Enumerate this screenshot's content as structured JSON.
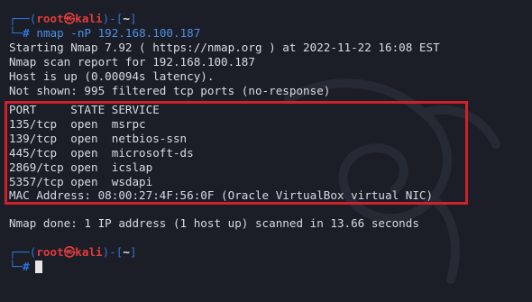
{
  "prompt": {
    "user": "root",
    "symbol": "㉿",
    "host": "kali",
    "dir": "~"
  },
  "command": "nmap -nP 192.168.100.187",
  "output": [
    "Starting Nmap 7.92 ( https://nmap.org ) at 2022-11-22 16:08 EST",
    "Nmap scan report for 192.168.100.187",
    "Host is up (0.00094s latency).",
    "Not shown: 995 filtered tcp ports (no-response)"
  ],
  "ports_header": "PORT     STATE SERVICE",
  "ports": [
    "135/tcp  open  msrpc",
    "139/tcp  open  netbios-ssn",
    "445/tcp  open  microsoft-ds",
    "2869/tcp open  icslap",
    "5357/tcp open  wsdapi"
  ],
  "mac_line": "MAC Address: 08:00:27:4F:56:0F (Oracle VirtualBox virtual NIC)",
  "done_line": "Nmap done: 1 IP address (1 host up) scanned in 13.66 seconds",
  "colors": {
    "background": "#1b1e27",
    "prompt_frame": "#2f73d6",
    "prompt_user": "#e03c3c",
    "highlight_box": "#d0202a"
  }
}
